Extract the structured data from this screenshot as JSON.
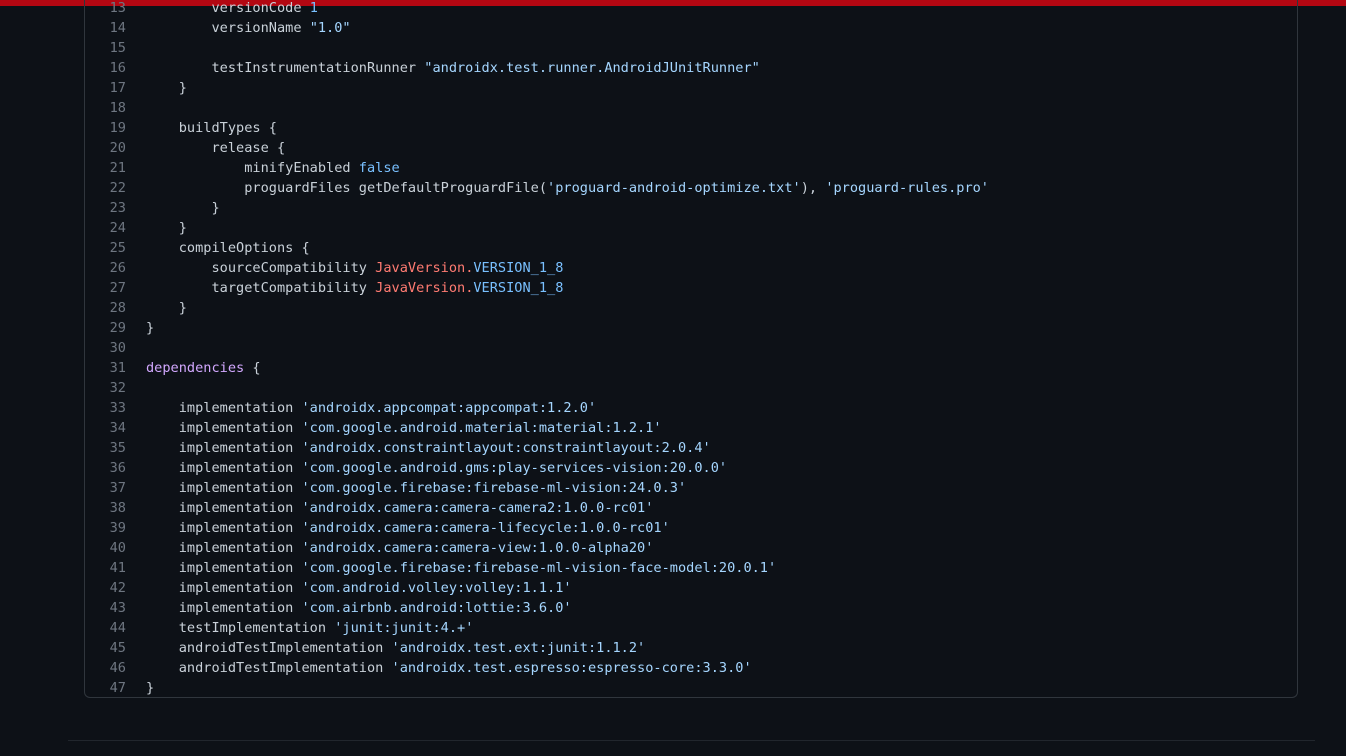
{
  "colors": {
    "background": "#0d1117",
    "accent_bar": "#b30712",
    "text": "#c9d1d9",
    "string": "#a5d6ff",
    "keyword": "#ff7b72",
    "constant": "#79c0ff",
    "entity": "#d2a8ff",
    "line_number": "#6e7681"
  },
  "code": {
    "lines": [
      {
        "num": "13",
        "tokens": [
          {
            "t": "        versionCode ",
            "c": "text"
          },
          {
            "t": "1",
            "c": "constant"
          }
        ]
      },
      {
        "num": "14",
        "tokens": [
          {
            "t": "        versionName ",
            "c": "text"
          },
          {
            "t": "\"1.0\"",
            "c": "string"
          }
        ]
      },
      {
        "num": "15",
        "tokens": []
      },
      {
        "num": "16",
        "tokens": [
          {
            "t": "        testInstrumentationRunner ",
            "c": "text"
          },
          {
            "t": "\"androidx.test.runner.AndroidJUnitRunner\"",
            "c": "string"
          }
        ]
      },
      {
        "num": "17",
        "tokens": [
          {
            "t": "    }",
            "c": "text"
          }
        ]
      },
      {
        "num": "18",
        "tokens": []
      },
      {
        "num": "19",
        "tokens": [
          {
            "t": "    buildTypes {",
            "c": "text"
          }
        ]
      },
      {
        "num": "20",
        "tokens": [
          {
            "t": "        release {",
            "c": "text"
          }
        ]
      },
      {
        "num": "21",
        "tokens": [
          {
            "t": "            minifyEnabled ",
            "c": "text"
          },
          {
            "t": "false",
            "c": "constant"
          }
        ]
      },
      {
        "num": "22",
        "tokens": [
          {
            "t": "            proguardFiles getDefaultProguardFile(",
            "c": "text"
          },
          {
            "t": "'proguard-android-optimize.txt'",
            "c": "string"
          },
          {
            "t": "), ",
            "c": "text"
          },
          {
            "t": "'proguard-rules.pro'",
            "c": "string"
          }
        ]
      },
      {
        "num": "23",
        "tokens": [
          {
            "t": "        }",
            "c": "text"
          }
        ]
      },
      {
        "num": "24",
        "tokens": [
          {
            "t": "    }",
            "c": "text"
          }
        ]
      },
      {
        "num": "25",
        "tokens": [
          {
            "t": "    compileOptions {",
            "c": "text"
          }
        ]
      },
      {
        "num": "26",
        "tokens": [
          {
            "t": "        sourceCompatibility ",
            "c": "text"
          },
          {
            "t": "JavaVersion",
            "c": "keyword"
          },
          {
            "t": ".",
            "c": "keyword"
          },
          {
            "t": "VERSION_1_8",
            "c": "constant"
          }
        ]
      },
      {
        "num": "27",
        "tokens": [
          {
            "t": "        targetCompatibility ",
            "c": "text"
          },
          {
            "t": "JavaVersion",
            "c": "keyword"
          },
          {
            "t": ".",
            "c": "keyword"
          },
          {
            "t": "VERSION_1_8",
            "c": "constant"
          }
        ]
      },
      {
        "num": "28",
        "tokens": [
          {
            "t": "    }",
            "c": "text"
          }
        ]
      },
      {
        "num": "29",
        "tokens": [
          {
            "t": "}",
            "c": "text"
          }
        ]
      },
      {
        "num": "30",
        "tokens": []
      },
      {
        "num": "31",
        "tokens": [
          {
            "t": "dependencies",
            "c": "entity"
          },
          {
            "t": " {",
            "c": "text"
          }
        ]
      },
      {
        "num": "32",
        "tokens": []
      },
      {
        "num": "33",
        "tokens": [
          {
            "t": "    implementation ",
            "c": "text"
          },
          {
            "t": "'androidx.appcompat:appcompat:1.2.0'",
            "c": "string"
          }
        ]
      },
      {
        "num": "34",
        "tokens": [
          {
            "t": "    implementation ",
            "c": "text"
          },
          {
            "t": "'com.google.android.material:material:1.2.1'",
            "c": "string"
          }
        ]
      },
      {
        "num": "35",
        "tokens": [
          {
            "t": "    implementation ",
            "c": "text"
          },
          {
            "t": "'androidx.constraintlayout:constraintlayout:2.0.4'",
            "c": "string"
          }
        ]
      },
      {
        "num": "36",
        "tokens": [
          {
            "t": "    implementation ",
            "c": "text"
          },
          {
            "t": "'com.google.android.gms:play-services-vision:20.0.0'",
            "c": "string"
          }
        ]
      },
      {
        "num": "37",
        "tokens": [
          {
            "t": "    implementation ",
            "c": "text"
          },
          {
            "t": "'com.google.firebase:firebase-ml-vision:24.0.3'",
            "c": "string"
          }
        ]
      },
      {
        "num": "38",
        "tokens": [
          {
            "t": "    implementation ",
            "c": "text"
          },
          {
            "t": "'androidx.camera:camera-camera2:1.0.0-rc01'",
            "c": "string"
          }
        ]
      },
      {
        "num": "39",
        "tokens": [
          {
            "t": "    implementation ",
            "c": "text"
          },
          {
            "t": "'androidx.camera:camera-lifecycle:1.0.0-rc01'",
            "c": "string"
          }
        ]
      },
      {
        "num": "40",
        "tokens": [
          {
            "t": "    implementation ",
            "c": "text"
          },
          {
            "t": "'androidx.camera:camera-view:1.0.0-alpha20'",
            "c": "string"
          }
        ]
      },
      {
        "num": "41",
        "tokens": [
          {
            "t": "    implementation ",
            "c": "text"
          },
          {
            "t": "'com.google.firebase:firebase-ml-vision-face-model:20.0.1'",
            "c": "string"
          }
        ]
      },
      {
        "num": "42",
        "tokens": [
          {
            "t": "    implementation ",
            "c": "text"
          },
          {
            "t": "'com.android.volley:volley:1.1.1'",
            "c": "string"
          }
        ]
      },
      {
        "num": "43",
        "tokens": [
          {
            "t": "    implementation ",
            "c": "text"
          },
          {
            "t": "'com.airbnb.android:lottie:3.6.0'",
            "c": "string"
          }
        ]
      },
      {
        "num": "44",
        "tokens": [
          {
            "t": "    testImplementation ",
            "c": "text"
          },
          {
            "t": "'junit:junit:4.+'",
            "c": "string"
          }
        ]
      },
      {
        "num": "45",
        "tokens": [
          {
            "t": "    androidTestImplementation ",
            "c": "text"
          },
          {
            "t": "'androidx.test.ext:junit:1.1.2'",
            "c": "string"
          }
        ]
      },
      {
        "num": "46",
        "tokens": [
          {
            "t": "    androidTestImplementation ",
            "c": "text"
          },
          {
            "t": "'androidx.test.espresso:espresso-core:3.3.0'",
            "c": "string"
          }
        ]
      },
      {
        "num": "47",
        "tokens": [
          {
            "t": "}",
            "c": "text"
          }
        ]
      }
    ]
  }
}
